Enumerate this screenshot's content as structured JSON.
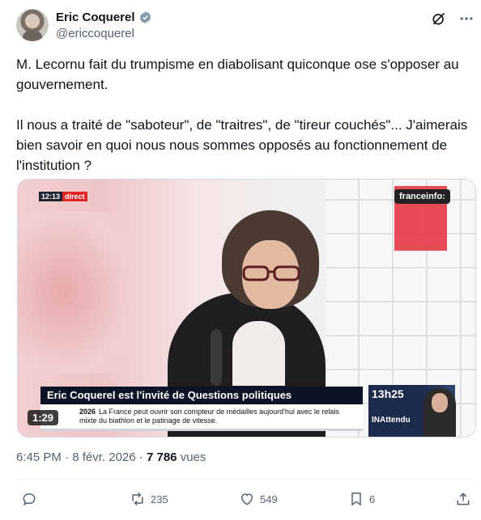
{
  "author": {
    "name": "Eric Coquerel",
    "handle": "@ericcoquerel"
  },
  "tweet": {
    "paragraphs": [
      "M. Lecornu fait du trumpisme en diabolisant quiconque ose s'opposer au gouvernement.",
      "Il nous a traité de \"saboteur\", de \"traitres\", de \"tireur couchés\"... J'aimerais bien savoir en quoi nous nous sommes opposés au fonctionnement de l'institution ?"
    ]
  },
  "media": {
    "clock": "12:13",
    "live_label": "direct",
    "channel": "franceinfo:",
    "headline": "Eric Coquerel est l'invité de Questions politiques",
    "ticker_year": "2026",
    "ticker_text": "La France peut ouvrir son compteur de médailles aujourd'hui avec le relais mixte du biathlon et le patinage de vitesse.",
    "next_time": "13h25",
    "next_show": "INAttendu",
    "duration": "1:29"
  },
  "meta": {
    "time": "6:45 PM",
    "separator": "·",
    "date": "8 févr. 2026",
    "views_count": "7 786",
    "views_label": "vues"
  },
  "actions": {
    "replies": "",
    "reposts": "235",
    "likes": "549",
    "bookmarks": "6"
  },
  "icons": {
    "verified": "verified-badge-icon",
    "grok": "grok-icon",
    "more": "more-icon",
    "reply": "reply-icon",
    "repost": "repost-icon",
    "like": "like-icon",
    "bookmark": "bookmark-icon",
    "share": "share-icon"
  },
  "colors": {
    "text": "#0f1419",
    "secondary": "#536471",
    "verified": "#829aab"
  }
}
